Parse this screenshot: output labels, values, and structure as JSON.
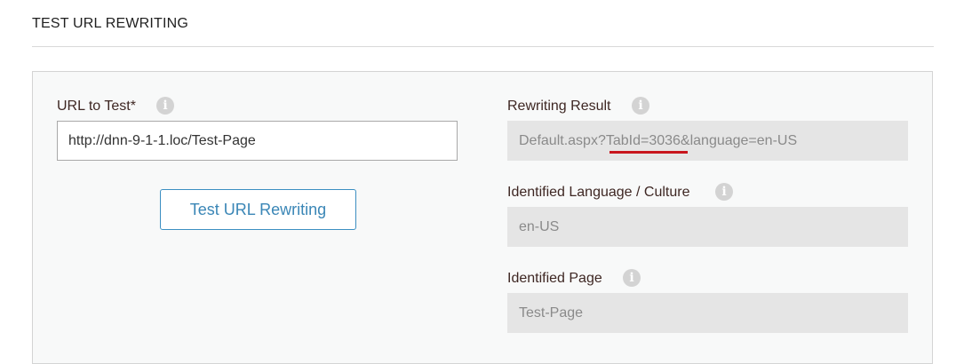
{
  "section": {
    "title": "TEST URL REWRITING"
  },
  "left": {
    "url_label": "URL to Test*",
    "url_value": "http://dnn-9-1-1.loc/Test-Page",
    "test_button_label": "Test URL Rewriting"
  },
  "right": {
    "rewriting_result_label": "Rewriting Result",
    "rewriting_result_value": "Default.aspx?TabId=3036&language=en-US",
    "language_label": "Identified Language / Culture",
    "language_value": "en-US",
    "page_label": "Identified Page",
    "page_value": "Test-Page"
  },
  "icons": {
    "info": "i"
  },
  "colors": {
    "button_accent": "#3c8fc2",
    "highlight_underline": "#c8161d",
    "readonly_bg": "#e5e5e5"
  }
}
